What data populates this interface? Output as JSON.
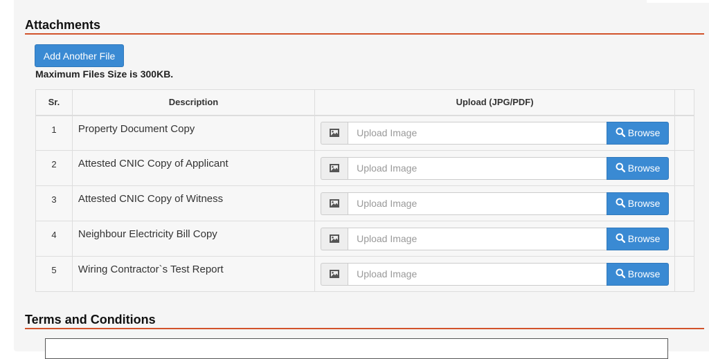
{
  "attachments": {
    "title": "Attachments",
    "add_button_label": "Add Another File",
    "max_size_note": "Maximum Files Size is 300KB.",
    "columns": [
      "Sr.",
      "Description",
      "Upload (JPG/PDF)"
    ],
    "rows": [
      {
        "sr": "1",
        "description": "Property Document Copy",
        "placeholder": "Upload Image",
        "browse": "Browse"
      },
      {
        "sr": "2",
        "description": "Attested CNIC Copy of Applicant",
        "placeholder": "Upload Image",
        "browse": "Browse"
      },
      {
        "sr": "3",
        "description": "Attested CNIC Copy of Witness",
        "placeholder": "Upload Image",
        "browse": "Browse"
      },
      {
        "sr": "4",
        "description": "Neighbour Electricity Bill Copy",
        "placeholder": "Upload Image",
        "browse": "Browse"
      },
      {
        "sr": "5",
        "description": "Wiring Contractor`s Test Report",
        "placeholder": "Upload Image",
        "browse": "Browse"
      }
    ]
  },
  "terms": {
    "title": "Terms and Conditions"
  },
  "colors": {
    "accent": "#3a8ad3",
    "section_rule": "#d2522a",
    "panel_bg": "#f5f5f5"
  },
  "icons": {
    "image_addon": "image-icon",
    "browse": "search-icon"
  }
}
